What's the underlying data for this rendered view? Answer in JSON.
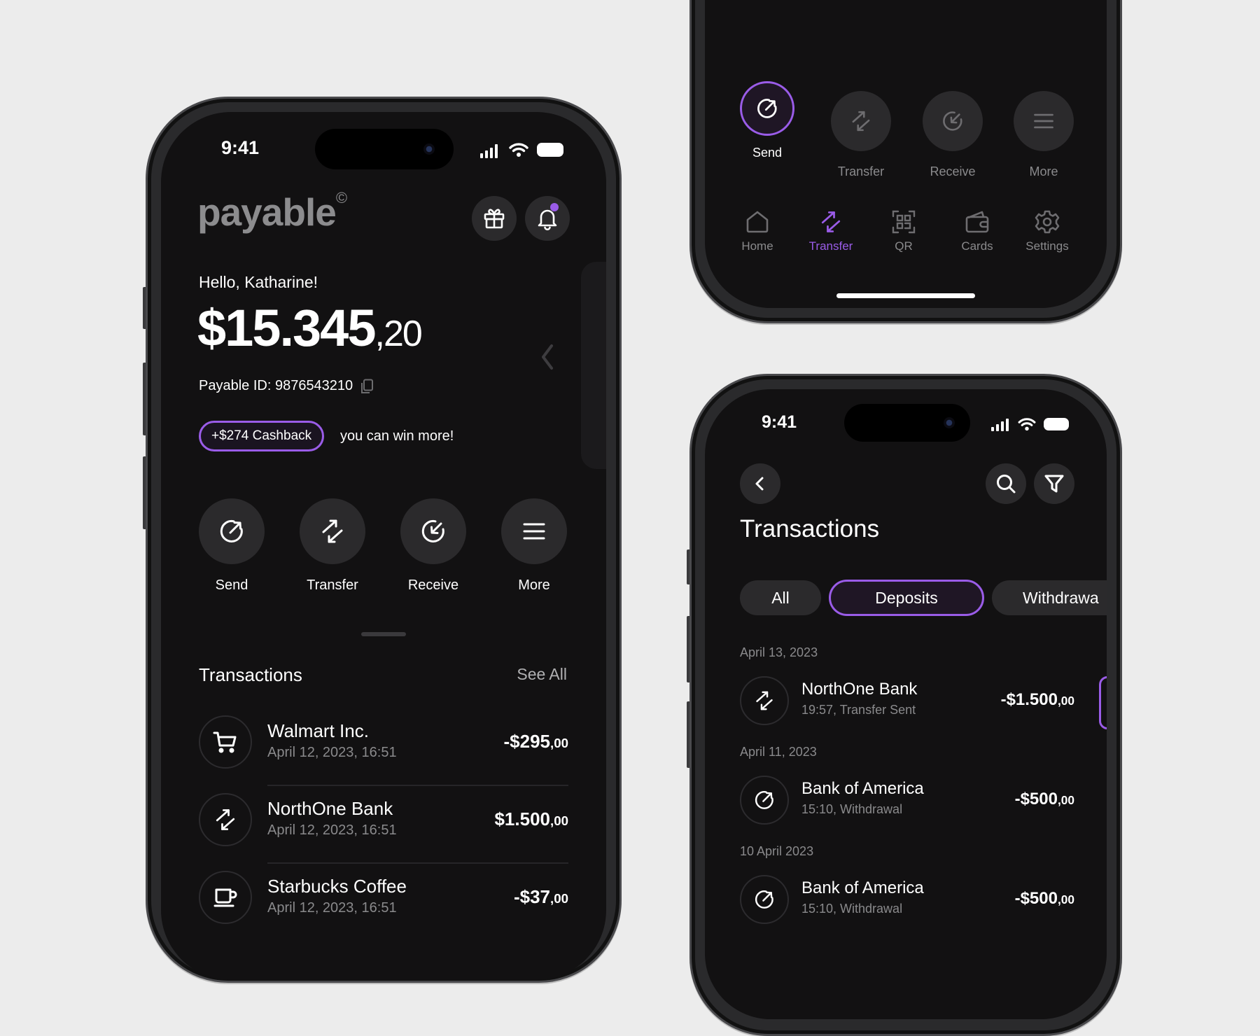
{
  "colors": {
    "accent": "#9a5ce8",
    "screen_bg": "#121112",
    "button_bg": "#2b2a2c",
    "muted_text": "#8a8a8c",
    "page_bg": "#ececec"
  },
  "home": {
    "status_time": "9:41",
    "brand": "payable",
    "brand_mark": "©",
    "greeting": "Hello, Katharine!",
    "balance": {
      "main": "$15.345",
      "decimal": ",20"
    },
    "payable_id": "Payable ID: 9876543210",
    "cashback_badge": "+$274 Cashback",
    "cashback_note": "you can win more!",
    "actions": [
      {
        "label": "Send",
        "icon": "send-icon"
      },
      {
        "label": "Transfer",
        "icon": "transfer-icon"
      },
      {
        "label": "Receive",
        "icon": "receive-icon"
      },
      {
        "label": "More",
        "icon": "menu-icon"
      }
    ],
    "transactions_title": "Transactions",
    "see_all": "See All",
    "transactions": [
      {
        "name": "Walmart Inc.",
        "date": "April 12, 2023, 16:51",
        "amount": "-$295",
        "decimal": ",00",
        "icon": "cart-icon"
      },
      {
        "name": "NorthOne Bank",
        "date": "April 12, 2023, 16:51",
        "amount": "$1.500",
        "decimal": ",00",
        "icon": "transfer-icon"
      },
      {
        "name": "Starbucks Coffee",
        "date": "April 12, 2023, 16:51",
        "amount": "-$37",
        "decimal": ",00",
        "icon": "coffee-cup-icon"
      }
    ]
  },
  "menu_screen": {
    "actions": [
      {
        "label": "Send",
        "icon": "send-icon",
        "active": true
      },
      {
        "label": "Transfer",
        "icon": "transfer-icon",
        "active": false
      },
      {
        "label": "Receive",
        "icon": "receive-icon",
        "active": false
      },
      {
        "label": "More",
        "icon": "menu-icon",
        "active": false
      }
    ],
    "tab_bar": [
      {
        "label": "Home",
        "icon": "home-icon",
        "active": false
      },
      {
        "label": "Transfer",
        "icon": "transfer-icon",
        "active": true
      },
      {
        "label": "QR",
        "icon": "qr-scan-icon",
        "active": false
      },
      {
        "label": "Cards",
        "icon": "wallet-icon",
        "active": false
      },
      {
        "label": "Settings",
        "icon": "gear-icon",
        "active": false
      }
    ]
  },
  "transactions_screen": {
    "status_time": "9:41",
    "title": "Transactions",
    "filters": [
      {
        "label": "All",
        "active": false
      },
      {
        "label": "Deposits",
        "active": true
      },
      {
        "label": "Withdrawa",
        "active": false
      }
    ],
    "groups": [
      {
        "date": "April 13, 2023",
        "items": [
          {
            "name": "NorthOne Bank",
            "meta": "19:57, Transfer Sent",
            "amount": "-$1.500",
            "decimal": ",00",
            "icon": "transfer-icon"
          }
        ]
      },
      {
        "date": "April 11, 2023",
        "items": [
          {
            "name": "Bank of America",
            "meta": "15:10, Withdrawal",
            "amount": "-$500",
            "decimal": ",00",
            "icon": "send-icon"
          }
        ]
      },
      {
        "date": "10 April 2023",
        "items": [
          {
            "name": "Bank of America",
            "meta": "15:10, Withdrawal",
            "amount": "-$500",
            "decimal": ",00",
            "icon": "send-icon"
          }
        ]
      }
    ]
  }
}
